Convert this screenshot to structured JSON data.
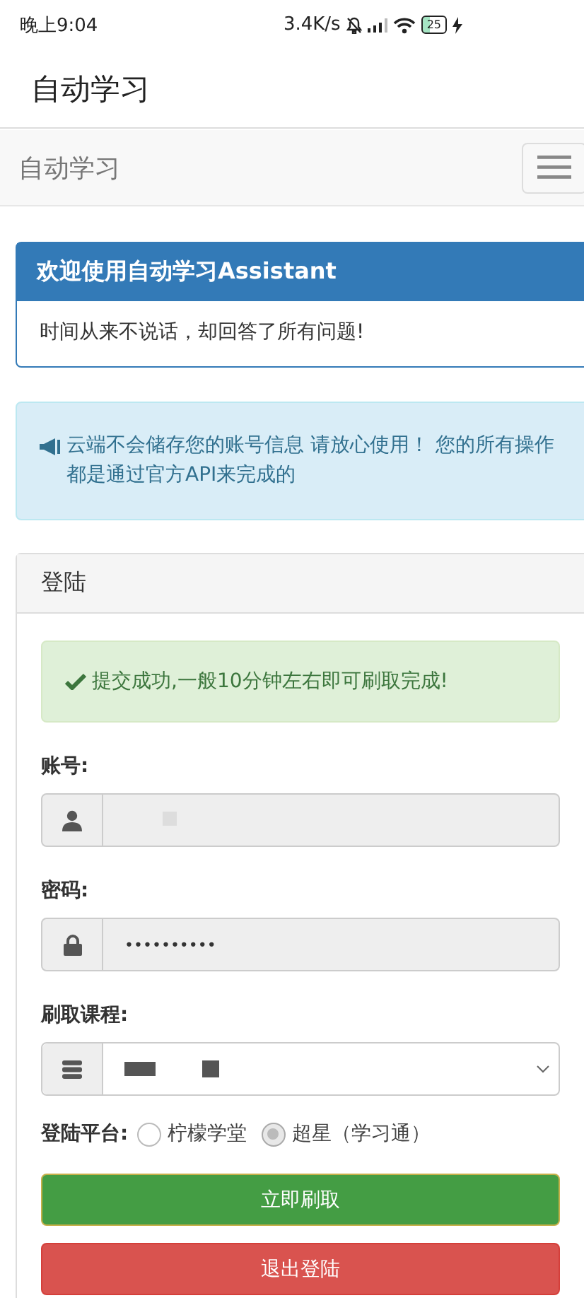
{
  "status_bar": {
    "time": "晚上9:04",
    "speed": "3.4K/s",
    "battery": "25"
  },
  "app_bar": {
    "title": "自动学习"
  },
  "navbar": {
    "brand": "自动学习"
  },
  "welcome_panel": {
    "title": "欢迎使用自动学习Assistant",
    "body": "时间从来不说话，却回答了所有问题!"
  },
  "info_alert": {
    "text": "云端不会储存您的账号信息 请放心使用！ 您的所有操作都是通过官方API来完成的"
  },
  "login_panel": {
    "title": "登陆",
    "success_alert": "提交成功,一般10分钟左右即可刷取完成!",
    "fields": [
      {
        "kind": "account",
        "label": "账号:"
      },
      {
        "kind": "password",
        "label": "密码:",
        "value": "••••••••••"
      },
      {
        "kind": "course",
        "label": "刷取课程:"
      }
    ],
    "platform": {
      "label": "登陆平台:",
      "options": [
        {
          "label": "柠檬学堂",
          "selected": false
        },
        {
          "label": "超星（学习通）",
          "selected": true
        }
      ]
    },
    "buttons": [
      {
        "kind": "primary",
        "label": "立即刷取"
      },
      {
        "kind": "danger",
        "label": "退出登陆"
      }
    ]
  }
}
